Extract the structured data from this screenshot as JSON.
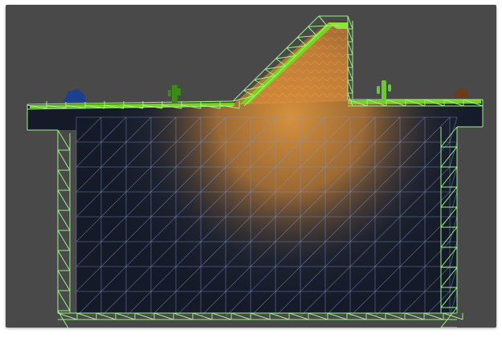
{
  "scene": {
    "background_color": "#494949",
    "terrain_fill_dark": "#141a28",
    "glow_color": "#d38a3a",
    "wire_color": "#9ff08a",
    "inner_wire_color": "#7f95c8",
    "grass_color": "#7ad21c"
  },
  "props": [
    {
      "name": "blue-rock-icon",
      "color": "#1d3f8f"
    },
    {
      "name": "green-plant-icon",
      "color": "#3c8a17"
    },
    {
      "name": "cactus-icon",
      "color": "#70c63a"
    },
    {
      "name": "brown-rock-icon",
      "color": "#6a3b1d"
    }
  ]
}
